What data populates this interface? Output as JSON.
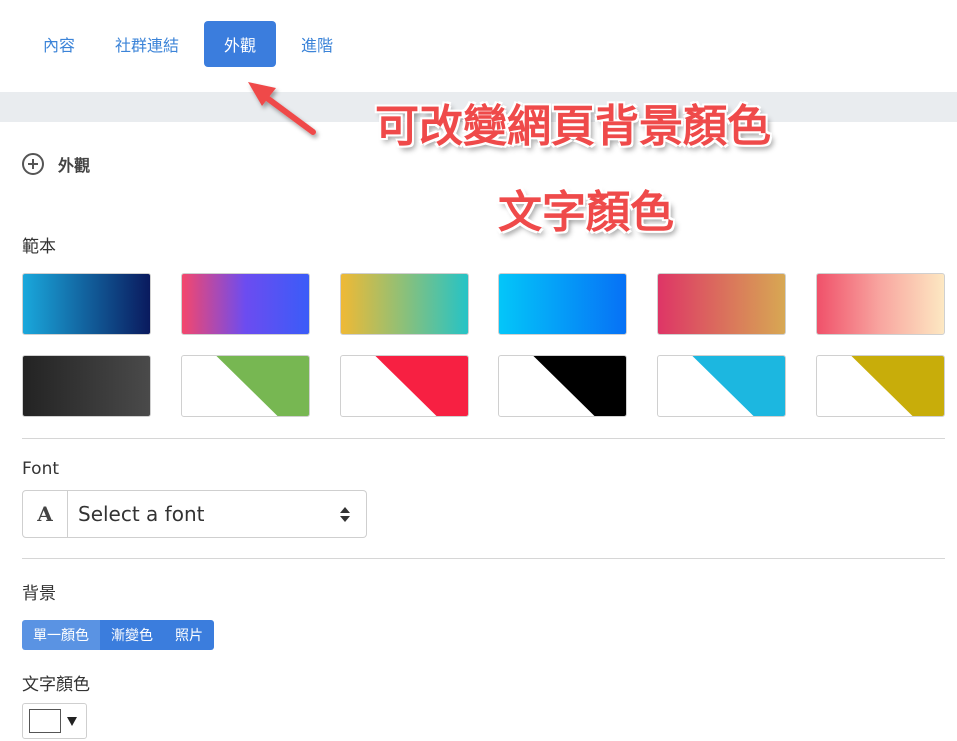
{
  "tabs": [
    {
      "label": "內容"
    },
    {
      "label": "社群連結"
    },
    {
      "label": "外觀"
    },
    {
      "label": "進階"
    }
  ],
  "active_tab": "外觀",
  "annotation": {
    "line1": "可改變網頁背景顏色",
    "line2": "文字顏色",
    "color": "#ef4a4a"
  },
  "section": {
    "title": "外觀",
    "icon": "plus-circle-icon"
  },
  "templates": {
    "label": "範本",
    "swatches": [
      {
        "style": "gradient",
        "colors": [
          "#1aa8dc",
          "#0a1a5e"
        ]
      },
      {
        "style": "gradient",
        "colors": [
          "#f4476c",
          "#6c4cf0",
          "#3a5cf8"
        ]
      },
      {
        "style": "gradient",
        "colors": [
          "#efb935",
          "#8bc07a",
          "#25c3c6"
        ]
      },
      {
        "style": "gradient",
        "colors": [
          "#04c6f9",
          "#0671f6"
        ]
      },
      {
        "style": "gradient",
        "colors": [
          "#de3566",
          "#d7a853"
        ]
      },
      {
        "style": "gradient",
        "colors": [
          "#f0516a",
          "#f8a6a0",
          "#fde8c2"
        ]
      },
      {
        "style": "gradient",
        "colors": [
          "#232323",
          "#4a4a4a"
        ]
      },
      {
        "style": "split",
        "colors": [
          "#ffffff",
          "#77b752"
        ]
      },
      {
        "style": "split",
        "colors": [
          "#ffffff",
          "#f72042"
        ]
      },
      {
        "style": "split",
        "colors": [
          "#ffffff",
          "#000000"
        ]
      },
      {
        "style": "split",
        "colors": [
          "#ffffff",
          "#1cb7e0"
        ]
      },
      {
        "style": "split",
        "colors": [
          "#ffffff",
          "#c8ad0a"
        ]
      }
    ]
  },
  "font": {
    "label": "Font",
    "addon_icon": "A",
    "select_value": "Select a font"
  },
  "background": {
    "label": "背景",
    "options": [
      "單一顏色",
      "漸變色",
      "照片"
    ],
    "selected": "單一顏色"
  },
  "text_color": {
    "label": "文字顏色",
    "value": "#ffffff"
  },
  "accent_color": "#3b7ddd"
}
